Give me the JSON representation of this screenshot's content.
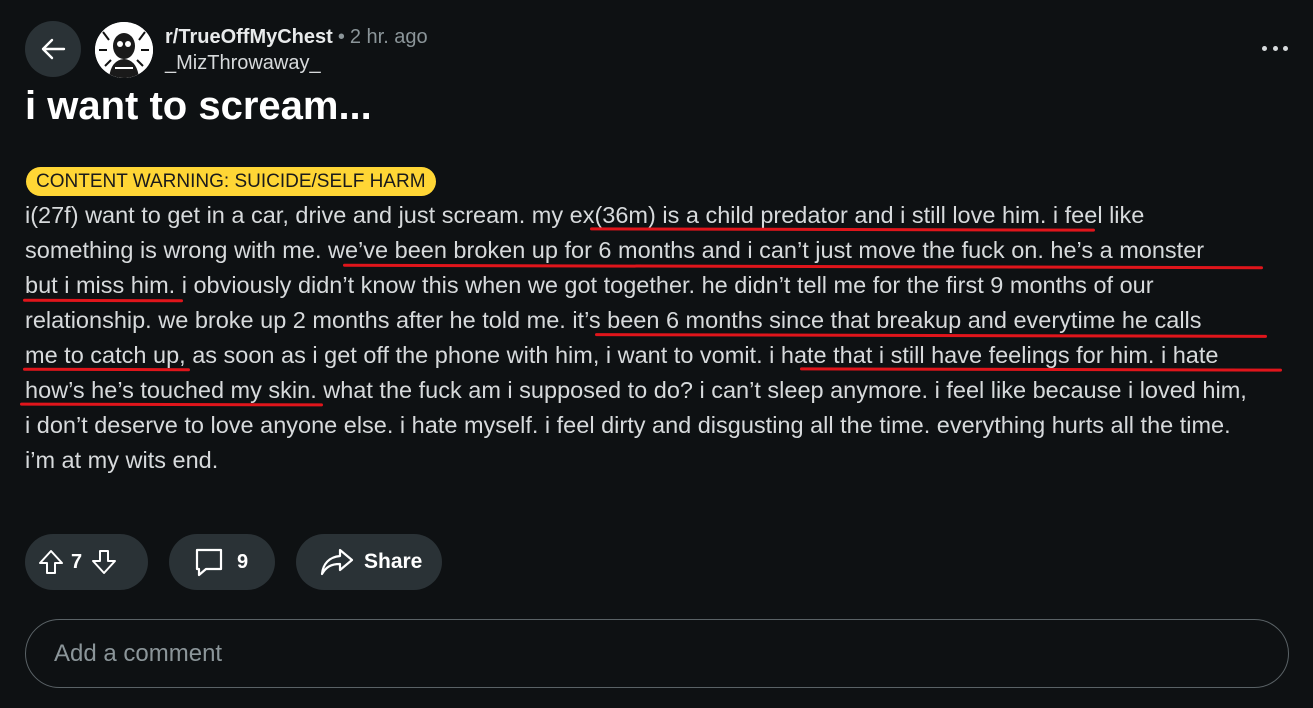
{
  "header": {
    "back_icon": "arrow-left-icon",
    "subreddit": "r/TrueOffMyChest",
    "separator": "•",
    "time_ago": "2 hr. ago",
    "author": "_MizThrowaway_",
    "more_icon": "ellipsis-horizontal-icon"
  },
  "post": {
    "title": "i want to scream...",
    "content_warning": "CONTENT WARNING: SUICIDE/SELF HARM",
    "body_lines": [
      "i(27f) want to get in a car, drive and just scream. my ex(36m) is a child predator and i still love him. i feel like",
      "something is wrong with me. we’ve been broken up for 6 months and i can’t just move the fuck on. he’s a monster",
      "but i miss him. i obviously didn’t know this when we got together. he didn’t tell me for the first 9 months of our",
      "relationship. we broke up 2 months after he told me. it’s been 6 months since that breakup and everytime he calls",
      "me to catch up, as soon as i get off the phone with him, i want to vomit. i hate that i still have feelings for him. i hate",
      "how’s he’s touched my skin. what the fuck am i supposed to do? i can’t sleep anymore. i feel like because i loved him,",
      "i don’t deserve to love anyone else. i hate myself. i feel dirty and disgusting all the time. everything hurts all the time.",
      "i’m at my wits end."
    ]
  },
  "actions": {
    "upvote_icon": "arrow-up-icon",
    "vote_count": "7",
    "downvote_icon": "arrow-down-icon",
    "comment_icon": "comment-bubble-icon",
    "comment_count": "9",
    "share_icon": "share-arrow-icon",
    "share_label": "Share"
  },
  "comment_box": {
    "placeholder": "Add a comment"
  },
  "colors": {
    "background": "#0e1113",
    "pill": "#2a3236",
    "warning_badge": "#ffd635",
    "underline": "#e0151b"
  }
}
